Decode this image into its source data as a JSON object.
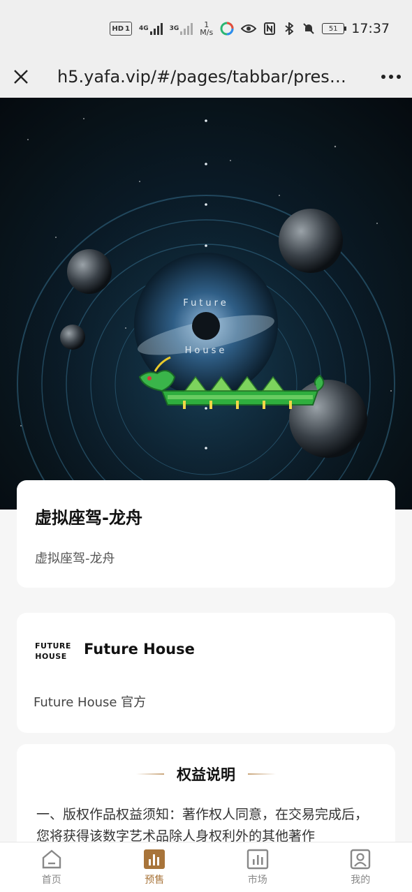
{
  "status_bar": {
    "hd": "HD",
    "sim": "1",
    "net1": "4G",
    "net2": "3G",
    "speed_value": "1",
    "speed_unit": "M/s",
    "battery": "51",
    "time": "17:37"
  },
  "browser": {
    "url": "h5.yafa.vip/#/pages/tabbar/presal..."
  },
  "hero": {
    "line1": "Future",
    "line2": "House"
  },
  "product": {
    "title": "虚拟座驾-龙舟",
    "subtitle": "虚拟座驾-龙舟"
  },
  "brand": {
    "logo_line1": "FUTURE",
    "logo_line2": "HOUSE",
    "name": "Future House",
    "official": "Future House 官方"
  },
  "rights": {
    "heading": "权益说明",
    "body": "一、版权作品权益须知：著作权人同意，在交易完成后，您将获得该数字艺术品除人身权利外的其他著作"
  },
  "tabbar": {
    "tabs": [
      {
        "label": "首页",
        "icon": "home-icon"
      },
      {
        "label": "预售",
        "icon": "presale-chart-icon"
      },
      {
        "label": "市场",
        "icon": "market-chart-icon"
      },
      {
        "label": "我的",
        "icon": "profile-icon"
      }
    ],
    "active_index": 1
  },
  "colors": {
    "accent": "#a8743a",
    "background": "#f6f6f6"
  }
}
